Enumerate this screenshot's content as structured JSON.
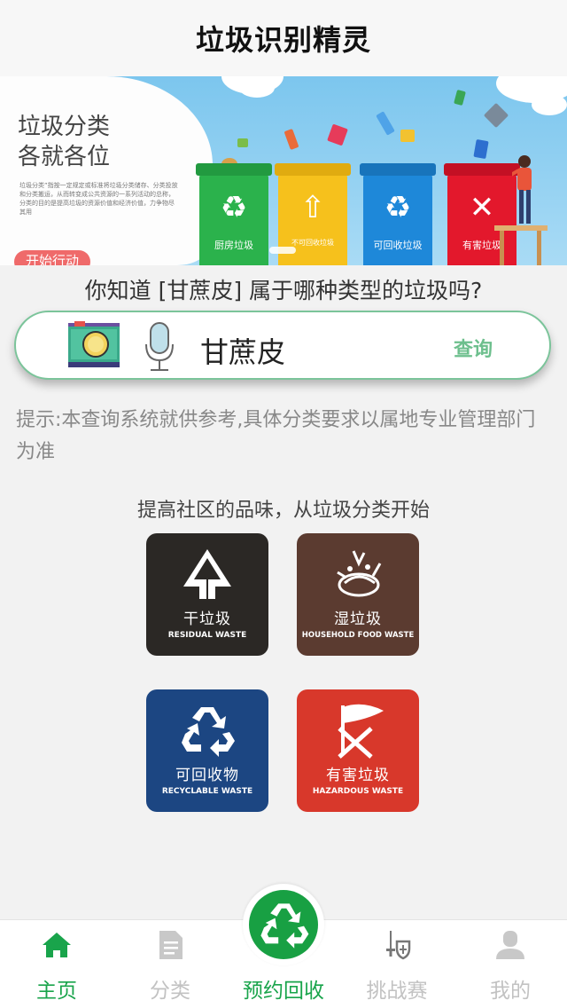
{
  "app": {
    "title": "垃圾识别精灵"
  },
  "banner": {
    "headline_line1": "垃圾分类",
    "headline_line2": "各就各位",
    "description": "垃圾分类”指按一定规定或标准将垃圾分类储存、分类投放和分类搬运，从而转变成公共资源的一系列活动的总称，分类的目的是提高垃圾的资源价值和经济价值，力争物尽其用",
    "start_button": "开始行动",
    "bins": [
      {
        "label": "厨房垃圾",
        "color": "#2bb24c"
      },
      {
        "label": "不可回收垃圾",
        "color": "#f6c11c"
      },
      {
        "label": "可回收垃圾",
        "color": "#1e88d9"
      },
      {
        "label": "有害垃圾",
        "color": "#e3182c"
      }
    ]
  },
  "question": "你知道 [甘蔗皮] 属于哪种类型的垃圾吗?",
  "search": {
    "term": "甘蔗皮",
    "query_button": "查询"
  },
  "hint": "提示:本查询系统就供参考,具体分类要求以属地专业管理部门为准",
  "slogan": "提高社区的品味，从垃圾分类开始",
  "categories": {
    "dry": {
      "name": "干垃圾",
      "en": "RESIDUAL WASTE",
      "icon": "residual-waste-icon"
    },
    "wet": {
      "name": "湿垃圾",
      "en": "HOUSEHOLD FOOD WASTE",
      "icon": "food-waste-icon"
    },
    "recyclable": {
      "name": "可回收物",
      "en": "RECYCLABLE WASTE",
      "icon": "recycle-icon"
    },
    "hazardous": {
      "name": "有害垃圾",
      "en": "HAZARDOUS WASTE",
      "icon": "hazardous-icon"
    }
  },
  "tabbar": {
    "home": "主页",
    "category": "分类",
    "recycle": "预约回收",
    "challenge": "挑战赛",
    "mine": "我的",
    "active": "home"
  },
  "colors": {
    "accent": "#19a44b",
    "search_border": "#7bc49a",
    "query": "#6dbf8d"
  }
}
